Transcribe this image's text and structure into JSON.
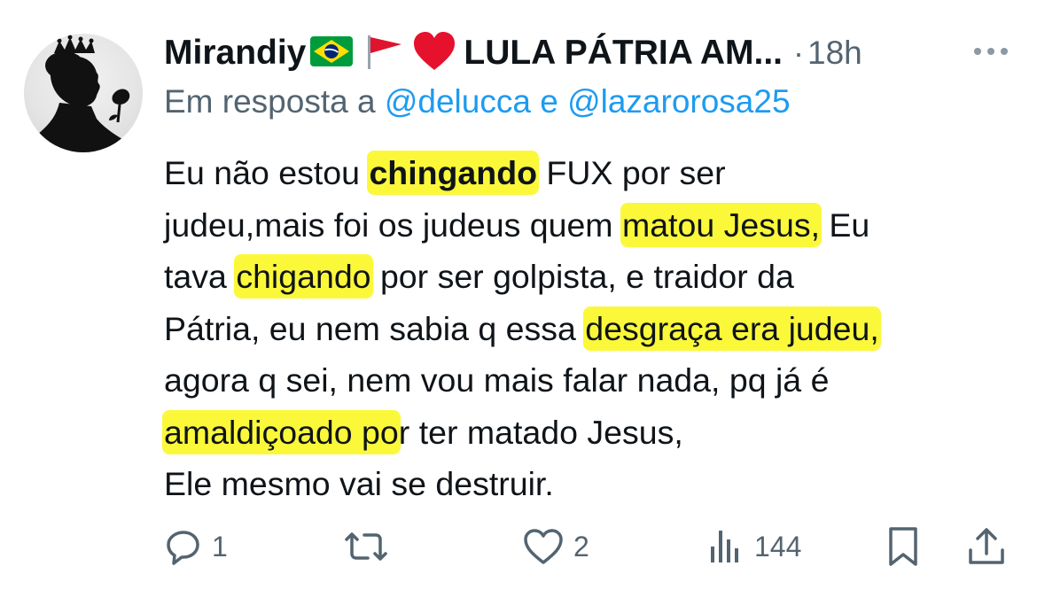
{
  "tweet": {
    "author_name": "Mirandiy",
    "author_name_suffix": "LULA PÁTRIA AM...",
    "icons": [
      "brazil-flag-icon",
      "red-flag-icon",
      "red-heart-icon"
    ],
    "dot": "·",
    "time": "18h",
    "reply_prefix": "Em resposta a",
    "reply_mention_1": "@delucca",
    "reply_conjunction": "e",
    "reply_mention_2": "@lazarorosa25",
    "body_lines": [
      {
        "parts": [
          {
            "text": "Eu não estou ",
            "hl": false
          },
          {
            "text": "chingando",
            "hl": true,
            "bold": true
          },
          {
            "text": " FUX por ser",
            "hl": false
          }
        ]
      },
      {
        "parts": [
          {
            "text": "judeu,mais foi os judeus quem ",
            "hl": false
          },
          {
            "text": "matou Jesus,",
            "hl": true
          },
          {
            "text": " Eu",
            "hl": false
          }
        ]
      },
      {
        "parts": [
          {
            "text": "tava ",
            "hl": false
          },
          {
            "text": "chigando",
            "hl": true
          },
          {
            "text": " por ser golpista, e traidor da",
            "hl": false
          }
        ]
      },
      {
        "parts": [
          {
            "text": "Pátria, eu nem sabia q essa ",
            "hl": false
          },
          {
            "text": "desgraça era judeu,",
            "hl": true
          }
        ]
      },
      {
        "parts": [
          {
            "text": "agora q sei, nem vou mais falar nada, pq já é",
            "hl": false
          }
        ]
      },
      {
        "parts": [
          {
            "text": "amaldiçoado po",
            "hl": true
          },
          {
            "text": "r ter matado Jesus,",
            "hl": false
          }
        ]
      },
      {
        "parts": [
          {
            "text": "Ele mesmo vai se destruir.",
            "hl": false
          }
        ]
      }
    ],
    "highlight_color": "#fbf83a",
    "text_color": "#0f1419",
    "muted_color": "#536471",
    "link_color": "#1d9bf0"
  },
  "actions": {
    "reply_count": "1",
    "retweet_count": "",
    "like_count": "2",
    "views_count": "144"
  }
}
